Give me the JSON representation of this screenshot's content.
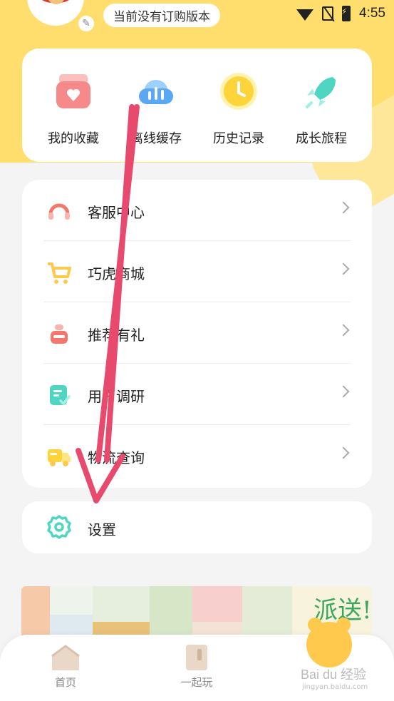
{
  "status_bar": {
    "subscription_text": "当前没有订购版本",
    "time": "4:55",
    "icons": [
      "wifi-icon",
      "no-sim-icon",
      "battery-charging-icon"
    ]
  },
  "quick_actions": [
    {
      "label": "我的收藏",
      "icon": "favorites-box-icon",
      "color": "#f68a8a"
    },
    {
      "label": "离线缓存",
      "icon": "cloud-download-icon",
      "color": "#5aa8f5"
    },
    {
      "label": "历史记录",
      "icon": "clock-icon",
      "color": "#ffd43b"
    },
    {
      "label": "成长旅程",
      "icon": "rocket-icon",
      "color": "#4fd6c2"
    }
  ],
  "menu": [
    {
      "label": "客服中心",
      "icon": "headset-icon",
      "color": "#f4776b"
    },
    {
      "label": "巧虎商城",
      "icon": "cart-icon",
      "color": "#ffc94d"
    },
    {
      "label": "推荐有礼",
      "icon": "gift-icon",
      "color": "#f4776b"
    },
    {
      "label": "用户调研",
      "icon": "survey-icon",
      "color": "#4fd6c2"
    },
    {
      "label": "物流查询",
      "icon": "truck-icon",
      "color": "#ffd43b"
    }
  ],
  "settings": {
    "label": "设置",
    "icon": "gear-icon",
    "color": "#4fd6c2"
  },
  "banner": {
    "text": "派送!"
  },
  "tabs": [
    {
      "label": "首页",
      "icon": "home-icon"
    },
    {
      "label": "一起玩",
      "icon": "play-book-icon"
    },
    {
      "label": "",
      "icon": "bear-icon"
    }
  ],
  "watermark": {
    "brand": "Bai du 经验",
    "url": "jingyan.baidu.com"
  },
  "colors": {
    "header_yellow": "#ffde6e",
    "annotation_pink": "#e84a6e"
  }
}
